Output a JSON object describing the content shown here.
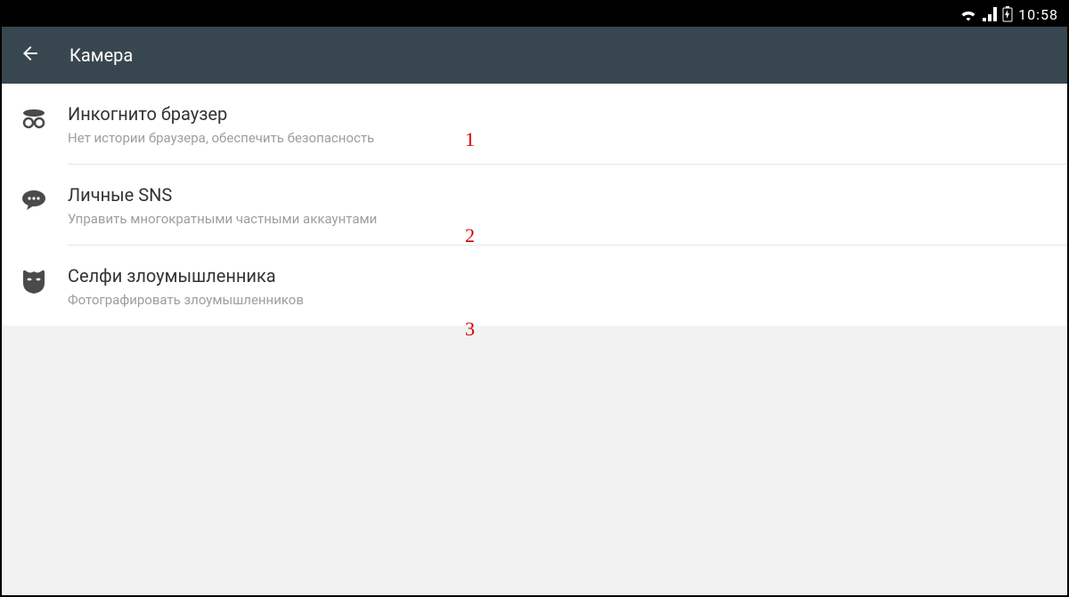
{
  "statusbar": {
    "time": "10:58"
  },
  "appbar": {
    "title": "Камера"
  },
  "list": {
    "items": [
      {
        "title": "Инкогнито браузер",
        "subtitle": "Нет истории браузера, обеспечить безопасность"
      },
      {
        "title": "Личные SNS",
        "subtitle": "Управить многократными частными аккаунтами"
      },
      {
        "title": "Селфи злоумышленника",
        "subtitle": "Фотографировать злоумышленников"
      }
    ]
  },
  "annotations": {
    "a1": "1",
    "a2": "2",
    "a3": "3"
  }
}
